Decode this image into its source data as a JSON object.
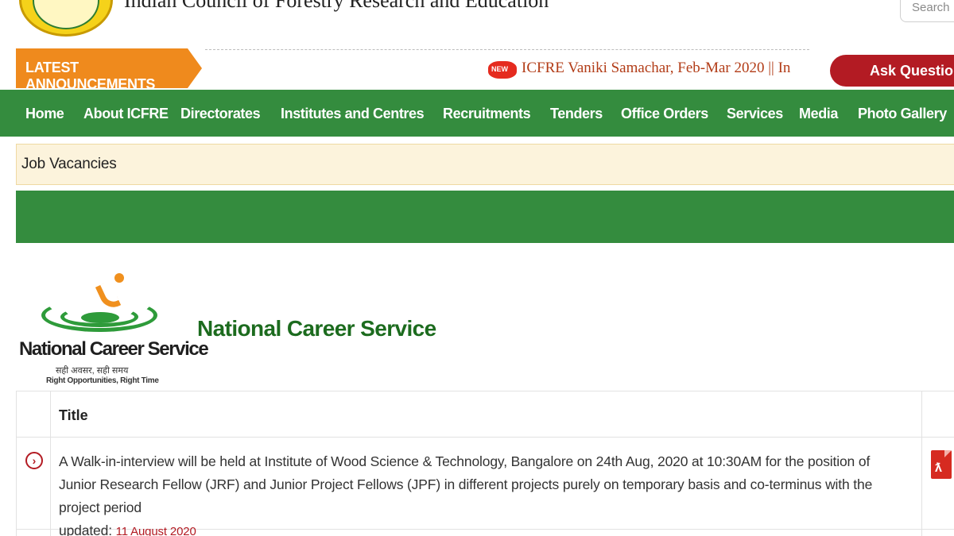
{
  "header": {
    "org_name": "Indian Council of Forestry Research and Education",
    "search_placeholder": "Search"
  },
  "announcements": {
    "label": "LATEST ANNOUNCEMENTS",
    "new_badge": "NEW",
    "marquee_text": "ICFRE Vaniki Samachar, Feb-Mar 2020 || In",
    "ask_button": "Ask Question"
  },
  "nav": {
    "items": [
      {
        "label": "Home"
      },
      {
        "label": "About ICFRE"
      },
      {
        "label": "Directorates"
      },
      {
        "label": "Institutes and Centres"
      },
      {
        "label": "Recruitments"
      },
      {
        "label": "Tenders"
      },
      {
        "label": "Office Orders"
      },
      {
        "label": "Services"
      },
      {
        "label": "Media"
      },
      {
        "label": "Photo Gallery"
      }
    ]
  },
  "breadcrumb": {
    "text": "Job Vacancies"
  },
  "ncs": {
    "logo_title": "National Career Service",
    "logo_hindi": "सही अवसर, सही समय",
    "logo_tagline": "Right Opportunities, Right Time",
    "heading": "National Career Service"
  },
  "table": {
    "header_title": "Title",
    "rows": [
      {
        "text": "A Walk-in-interview will be held at Institute of Wood Science & Technology, Bangalore on 24th Aug, 2020 at 10:30AM for the position of Junior Research Fellow (JRF) and Junior Project Fellows (JPF) in different projects purely on temporary basis and co-terminus with the project period",
        "updated_label": "updated:",
        "updated_date": "11 August 2020"
      }
    ]
  },
  "colors": {
    "nav_green": "#348c3e",
    "announcement_orange": "#ef8a1d",
    "accent_red": "#b31b23",
    "heading_green": "#1c6b1e",
    "breadcrumb_bg": "#fcf3dc"
  }
}
